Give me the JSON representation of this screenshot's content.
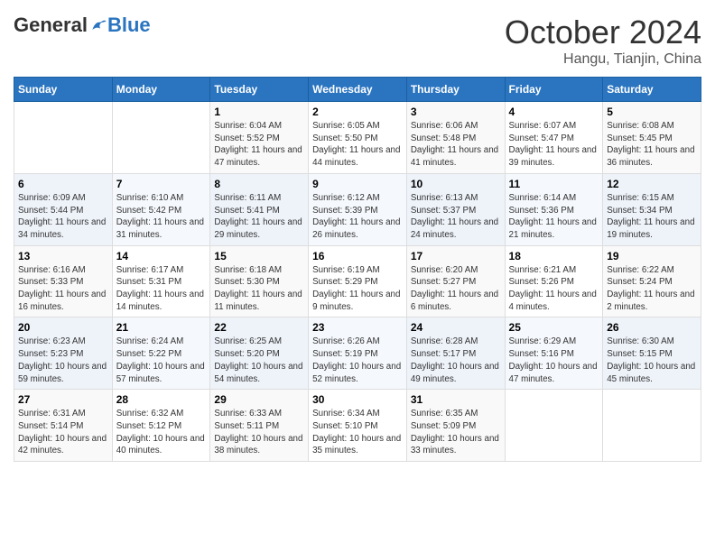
{
  "header": {
    "logo_general": "General",
    "logo_blue": "Blue",
    "month_title": "October 2024",
    "location": "Hangu, Tianjin, China"
  },
  "days_of_week": [
    "Sunday",
    "Monday",
    "Tuesday",
    "Wednesday",
    "Thursday",
    "Friday",
    "Saturday"
  ],
  "weeks": [
    [
      {
        "day": "",
        "sunrise": "",
        "sunset": "",
        "daylight": ""
      },
      {
        "day": "",
        "sunrise": "",
        "sunset": "",
        "daylight": ""
      },
      {
        "day": "1",
        "sunrise": "Sunrise: 6:04 AM",
        "sunset": "Sunset: 5:52 PM",
        "daylight": "Daylight: 11 hours and 47 minutes."
      },
      {
        "day": "2",
        "sunrise": "Sunrise: 6:05 AM",
        "sunset": "Sunset: 5:50 PM",
        "daylight": "Daylight: 11 hours and 44 minutes."
      },
      {
        "day": "3",
        "sunrise": "Sunrise: 6:06 AM",
        "sunset": "Sunset: 5:48 PM",
        "daylight": "Daylight: 11 hours and 41 minutes."
      },
      {
        "day": "4",
        "sunrise": "Sunrise: 6:07 AM",
        "sunset": "Sunset: 5:47 PM",
        "daylight": "Daylight: 11 hours and 39 minutes."
      },
      {
        "day": "5",
        "sunrise": "Sunrise: 6:08 AM",
        "sunset": "Sunset: 5:45 PM",
        "daylight": "Daylight: 11 hours and 36 minutes."
      }
    ],
    [
      {
        "day": "6",
        "sunrise": "Sunrise: 6:09 AM",
        "sunset": "Sunset: 5:44 PM",
        "daylight": "Daylight: 11 hours and 34 minutes."
      },
      {
        "day": "7",
        "sunrise": "Sunrise: 6:10 AM",
        "sunset": "Sunset: 5:42 PM",
        "daylight": "Daylight: 11 hours and 31 minutes."
      },
      {
        "day": "8",
        "sunrise": "Sunrise: 6:11 AM",
        "sunset": "Sunset: 5:41 PM",
        "daylight": "Daylight: 11 hours and 29 minutes."
      },
      {
        "day": "9",
        "sunrise": "Sunrise: 6:12 AM",
        "sunset": "Sunset: 5:39 PM",
        "daylight": "Daylight: 11 hours and 26 minutes."
      },
      {
        "day": "10",
        "sunrise": "Sunrise: 6:13 AM",
        "sunset": "Sunset: 5:37 PM",
        "daylight": "Daylight: 11 hours and 24 minutes."
      },
      {
        "day": "11",
        "sunrise": "Sunrise: 6:14 AM",
        "sunset": "Sunset: 5:36 PM",
        "daylight": "Daylight: 11 hours and 21 minutes."
      },
      {
        "day": "12",
        "sunrise": "Sunrise: 6:15 AM",
        "sunset": "Sunset: 5:34 PM",
        "daylight": "Daylight: 11 hours and 19 minutes."
      }
    ],
    [
      {
        "day": "13",
        "sunrise": "Sunrise: 6:16 AM",
        "sunset": "Sunset: 5:33 PM",
        "daylight": "Daylight: 11 hours and 16 minutes."
      },
      {
        "day": "14",
        "sunrise": "Sunrise: 6:17 AM",
        "sunset": "Sunset: 5:31 PM",
        "daylight": "Daylight: 11 hours and 14 minutes."
      },
      {
        "day": "15",
        "sunrise": "Sunrise: 6:18 AM",
        "sunset": "Sunset: 5:30 PM",
        "daylight": "Daylight: 11 hours and 11 minutes."
      },
      {
        "day": "16",
        "sunrise": "Sunrise: 6:19 AM",
        "sunset": "Sunset: 5:29 PM",
        "daylight": "Daylight: 11 hours and 9 minutes."
      },
      {
        "day": "17",
        "sunrise": "Sunrise: 6:20 AM",
        "sunset": "Sunset: 5:27 PM",
        "daylight": "Daylight: 11 hours and 6 minutes."
      },
      {
        "day": "18",
        "sunrise": "Sunrise: 6:21 AM",
        "sunset": "Sunset: 5:26 PM",
        "daylight": "Daylight: 11 hours and 4 minutes."
      },
      {
        "day": "19",
        "sunrise": "Sunrise: 6:22 AM",
        "sunset": "Sunset: 5:24 PM",
        "daylight": "Daylight: 11 hours and 2 minutes."
      }
    ],
    [
      {
        "day": "20",
        "sunrise": "Sunrise: 6:23 AM",
        "sunset": "Sunset: 5:23 PM",
        "daylight": "Daylight: 10 hours and 59 minutes."
      },
      {
        "day": "21",
        "sunrise": "Sunrise: 6:24 AM",
        "sunset": "Sunset: 5:22 PM",
        "daylight": "Daylight: 10 hours and 57 minutes."
      },
      {
        "day": "22",
        "sunrise": "Sunrise: 6:25 AM",
        "sunset": "Sunset: 5:20 PM",
        "daylight": "Daylight: 10 hours and 54 minutes."
      },
      {
        "day": "23",
        "sunrise": "Sunrise: 6:26 AM",
        "sunset": "Sunset: 5:19 PM",
        "daylight": "Daylight: 10 hours and 52 minutes."
      },
      {
        "day": "24",
        "sunrise": "Sunrise: 6:28 AM",
        "sunset": "Sunset: 5:17 PM",
        "daylight": "Daylight: 10 hours and 49 minutes."
      },
      {
        "day": "25",
        "sunrise": "Sunrise: 6:29 AM",
        "sunset": "Sunset: 5:16 PM",
        "daylight": "Daylight: 10 hours and 47 minutes."
      },
      {
        "day": "26",
        "sunrise": "Sunrise: 6:30 AM",
        "sunset": "Sunset: 5:15 PM",
        "daylight": "Daylight: 10 hours and 45 minutes."
      }
    ],
    [
      {
        "day": "27",
        "sunrise": "Sunrise: 6:31 AM",
        "sunset": "Sunset: 5:14 PM",
        "daylight": "Daylight: 10 hours and 42 minutes."
      },
      {
        "day": "28",
        "sunrise": "Sunrise: 6:32 AM",
        "sunset": "Sunset: 5:12 PM",
        "daylight": "Daylight: 10 hours and 40 minutes."
      },
      {
        "day": "29",
        "sunrise": "Sunrise: 6:33 AM",
        "sunset": "Sunset: 5:11 PM",
        "daylight": "Daylight: 10 hours and 38 minutes."
      },
      {
        "day": "30",
        "sunrise": "Sunrise: 6:34 AM",
        "sunset": "Sunset: 5:10 PM",
        "daylight": "Daylight: 10 hours and 35 minutes."
      },
      {
        "day": "31",
        "sunrise": "Sunrise: 6:35 AM",
        "sunset": "Sunset: 5:09 PM",
        "daylight": "Daylight: 10 hours and 33 minutes."
      },
      {
        "day": "",
        "sunrise": "",
        "sunset": "",
        "daylight": ""
      },
      {
        "day": "",
        "sunrise": "",
        "sunset": "",
        "daylight": ""
      }
    ]
  ]
}
